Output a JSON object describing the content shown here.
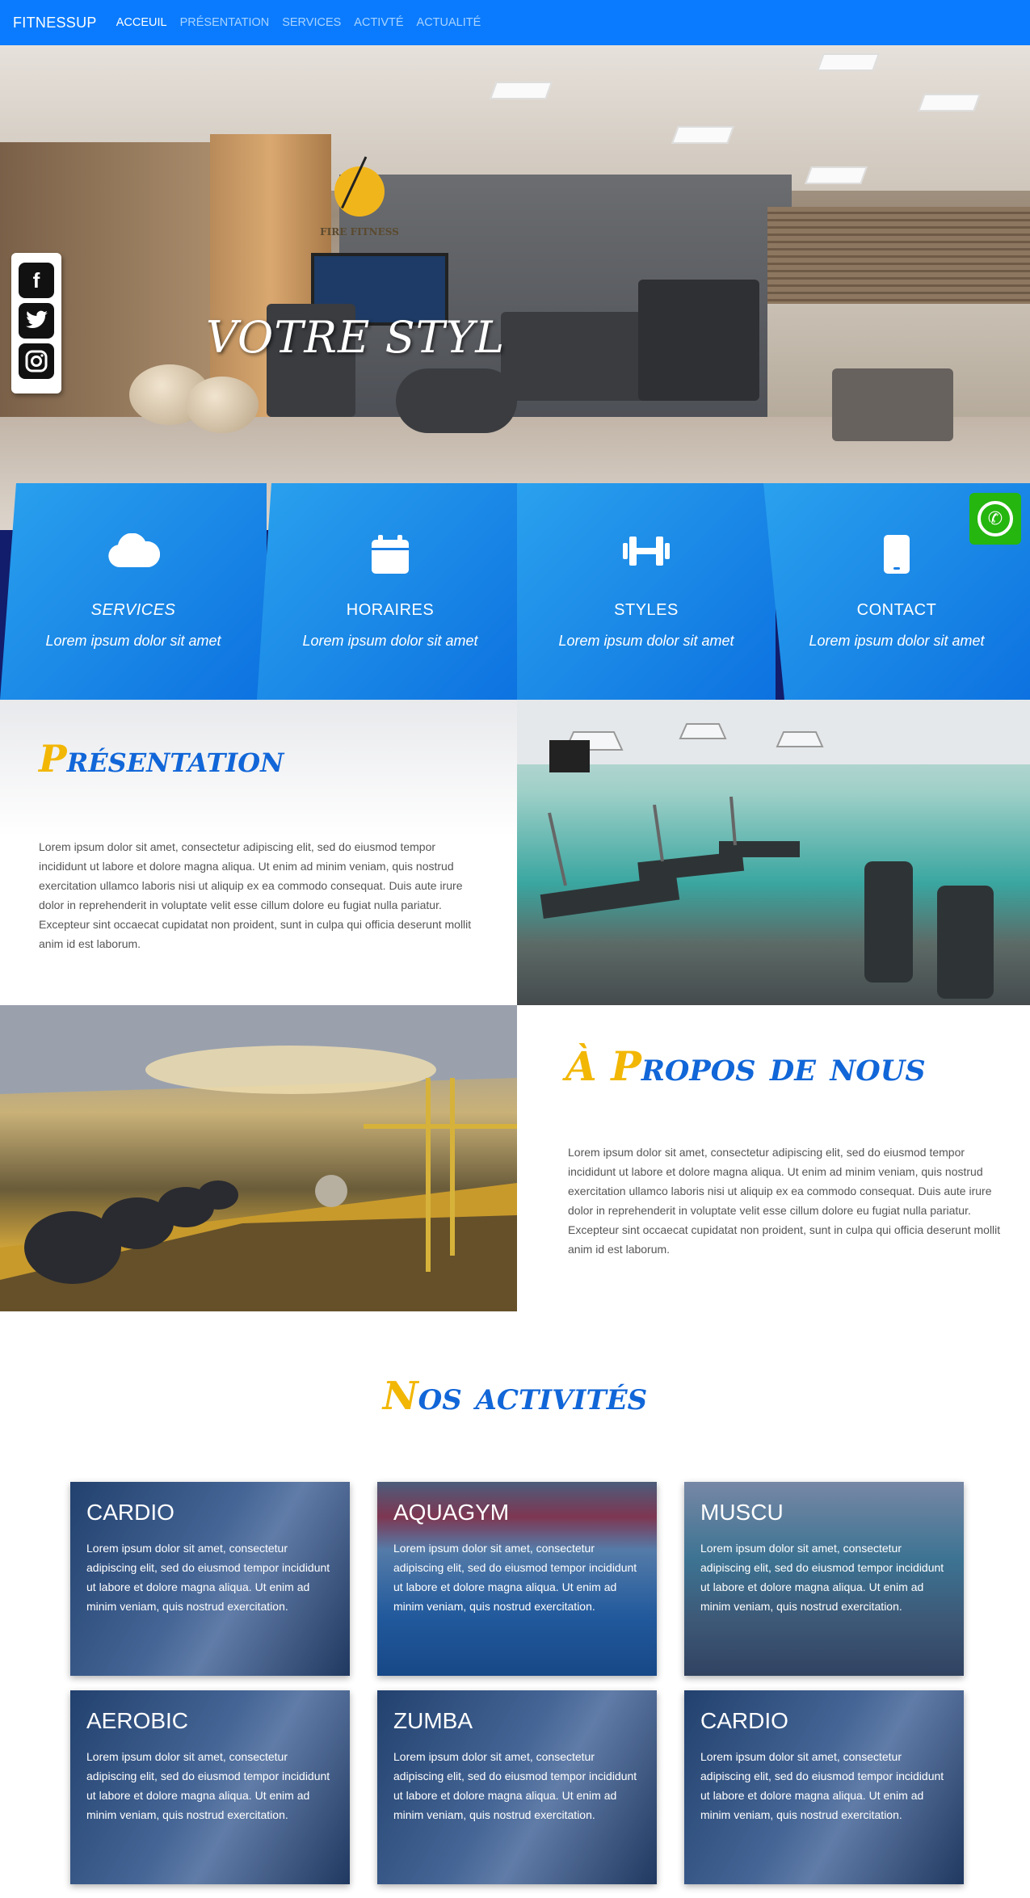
{
  "navbar": {
    "brand": "FITNESSUP",
    "links": [
      "ACCEUIL",
      "PRÉSENTATION",
      "SERVICES",
      "ACTIVTÉ",
      "ACTUALITÉ"
    ]
  },
  "hero": {
    "logo_text": "FIRE FITNESS",
    "title": "VOTRE STYL"
  },
  "social": [
    "facebook-icon",
    "twitter-icon",
    "instagram-icon"
  ],
  "features": [
    {
      "icon": "cloud-icon",
      "title": "SERVICES",
      "text": "Lorem ipsum dolor sit amet"
    },
    {
      "icon": "calendar-icon",
      "title": "HORAIRES",
      "text": "Lorem ipsum dolor sit amet"
    },
    {
      "icon": "dumbbell-icon",
      "title": "STYLES",
      "text": "Lorem ipsum dolor sit amet"
    },
    {
      "icon": "phone-icon",
      "title": "CONTACT",
      "text": "Lorem ipsum dolor sit amet"
    }
  ],
  "presentation": {
    "title_cap": "P",
    "title_rest": "résentation",
    "text": "Lorem ipsum dolor sit amet, consectetur adipiscing elit, sed do eiusmod tempor incididunt ut labore et dolore magna aliqua. Ut enim ad minim veniam, quis nostrud exercitation ullamco laboris nisi ut aliquip ex ea commodo consequat. Duis aute irure dolor in reprehenderit in voluptate velit esse cillum dolore eu fugiat nulla pariatur. Excepteur sint occaecat cupidatat non proident, sunt in culpa qui officia deserunt mollit anim id est laborum."
  },
  "about": {
    "title_cap": "À P",
    "title_rest": "ropos de nous",
    "text": "Lorem ipsum dolor sit amet, consectetur adipiscing elit, sed do eiusmod tempor incididunt ut labore et dolore magna aliqua. Ut enim ad minim veniam, quis nostrud exercitation ullamco laboris nisi ut aliquip ex ea commodo consequat. Duis aute irure dolor in reprehenderit in voluptate velit esse cillum dolore eu fugiat nulla pariatur. Excepteur sint occaecat cupidatat non proident, sunt in culpa qui officia deserunt mollit anim id est laborum."
  },
  "activities": {
    "title_cap": "N",
    "title_rest": "os activités",
    "cards": [
      {
        "title": "CARDIO",
        "text": "Lorem ipsum dolor sit amet, consectetur adipiscing elit, sed do eiusmod tempor incididunt ut labore et dolore magna aliqua. Ut enim ad minim veniam, quis nostrud exercitation."
      },
      {
        "title": "AQUAGYM",
        "text": "Lorem ipsum dolor sit amet, consectetur adipiscing elit, sed do eiusmod tempor incididunt ut labore et dolore magna aliqua. Ut enim ad minim veniam, quis nostrud exercitation."
      },
      {
        "title": "MUSCU",
        "text": "Lorem ipsum dolor sit amet, consectetur adipiscing elit, sed do eiusmod tempor incididunt ut labore et dolore magna aliqua. Ut enim ad minim veniam, quis nostrud exercitation."
      },
      {
        "title": "AEROBIC",
        "text": "Lorem ipsum dolor sit amet, consectetur adipiscing elit, sed do eiusmod tempor incididunt ut labore et dolore magna aliqua. Ut enim ad minim veniam, quis nostrud exercitation."
      },
      {
        "title": "ZUMBA",
        "text": "Lorem ipsum dolor sit amet, consectetur adipiscing elit, sed do eiusmod tempor incididunt ut labore et dolore magna aliqua. Ut enim ad minim veniam, quis nostrud exercitation."
      },
      {
        "title": "CARDIO",
        "text": "Lorem ipsum dolor sit amet, consectetur adipiscing elit, sed do eiusmod tempor incididunt ut labore et dolore magna aliqua. Ut enim ad minim veniam, quis nostrud exercitation."
      }
    ]
  },
  "colors": {
    "navbar": "#0a7bfe",
    "feature_blue": "#0d72e0",
    "title_blue": "#1166d8",
    "title_gold": "#f2b705",
    "whatsapp": "#25b60f",
    "dark_navy": "#121d6b"
  }
}
